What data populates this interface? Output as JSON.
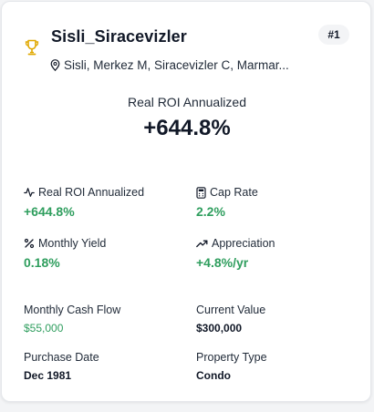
{
  "property": {
    "name": "Sisli_Siracevizler",
    "rank": "#1",
    "location": "Sisli, Merkez M, Siracevizler C, Marmar..."
  },
  "hero": {
    "label": "Real ROI Annualized",
    "value": "+644.8%"
  },
  "metrics": [
    {
      "label": "Real ROI Annualized",
      "value": "+644.8%",
      "icon": "activity-icon"
    },
    {
      "label": "Cap Rate",
      "value": "2.2%",
      "icon": "calculator-icon"
    },
    {
      "label": "Monthly Yield",
      "value": "0.18%",
      "icon": "percent-icon"
    },
    {
      "label": "Appreciation",
      "value": "+4.8%/yr",
      "icon": "trending-up-icon"
    }
  ],
  "details": [
    {
      "label": "Monthly Cash Flow",
      "value": "$55,000"
    },
    {
      "label": "Current Value",
      "value": "$300,000"
    },
    {
      "label": "Purchase Date",
      "value": "Dec 1981"
    },
    {
      "label": "Property Type",
      "value": "Condo"
    }
  ],
  "colors": {
    "accent_green": "#2f9e5e",
    "trophy": "#e0a800"
  }
}
